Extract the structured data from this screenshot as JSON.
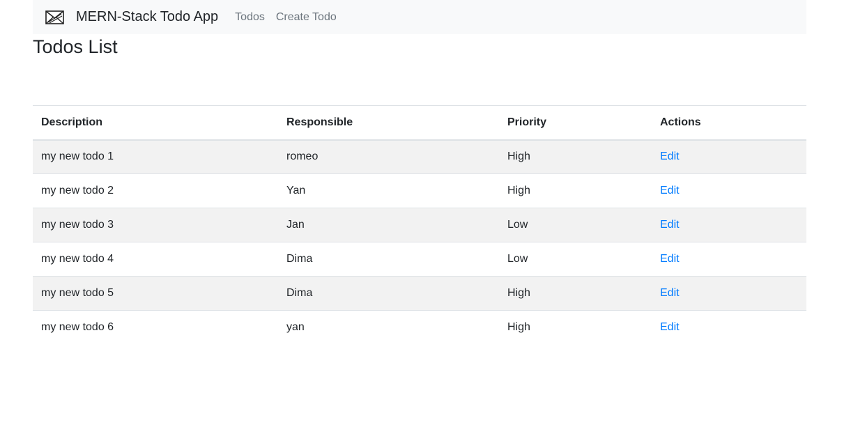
{
  "navbar": {
    "logo_icon": "envelope-logo-icon",
    "brand": "MERN-Stack Todo App",
    "links": [
      "Todos",
      "Create Todo"
    ]
  },
  "page": {
    "title": "Todos List"
  },
  "table": {
    "headers": [
      "Description",
      "Responsible",
      "Priority",
      "Actions"
    ],
    "rows": [
      {
        "description": "my new todo 1",
        "responsible": "romeo",
        "priority": "High",
        "action": "Edit"
      },
      {
        "description": "my new todo 2",
        "responsible": "Yan",
        "priority": "High",
        "action": "Edit"
      },
      {
        "description": "my new todo 3",
        "responsible": "Jan",
        "priority": "Low",
        "action": "Edit"
      },
      {
        "description": "my new todo 4",
        "responsible": "Dima",
        "priority": "Low",
        "action": "Edit"
      },
      {
        "description": "my new todo 5",
        "responsible": "Dima",
        "priority": "High",
        "action": "Edit"
      },
      {
        "description": "my new todo 6",
        "responsible": "yan",
        "priority": "High",
        "action": "Edit"
      }
    ]
  },
  "colors": {
    "navbar_bg": "#f8f9fa",
    "link": "#007bff",
    "nav_link": "#6c757d",
    "striped_row": "#f2f2f2"
  }
}
